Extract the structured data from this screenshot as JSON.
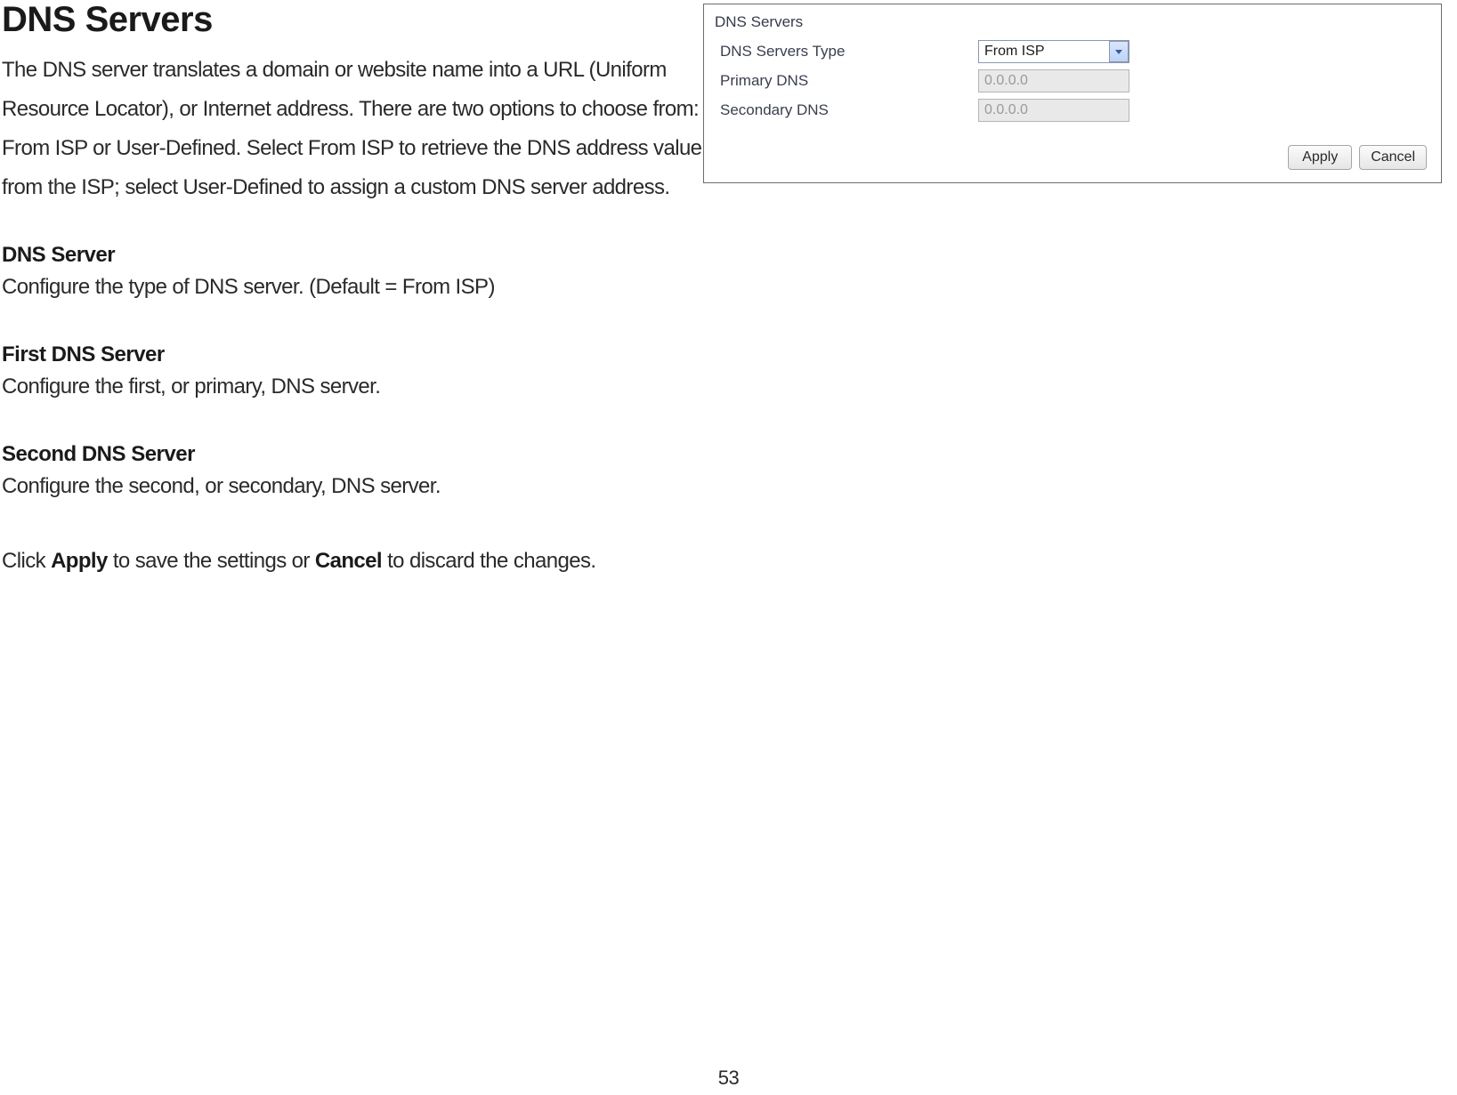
{
  "doc": {
    "heading": "DNS Servers",
    "intro": "The DNS server translates a domain or website name into a URL (Uniform Resource Locator), or Internet address. There are two options to choose from: From ISP or User-Defined. Select From ISP to retrieve the DNS address value from the ISP; select User-Defined to assign a custom DNS server address.",
    "sections": [
      {
        "title": "DNS Server",
        "body": "Configure the type of DNS server. (Default = From ISP)"
      },
      {
        "title": "First DNS Server",
        "body": "Configure the first, or primary, DNS server."
      },
      {
        "title": "Second DNS Server",
        "body": "Configure the second, or secondary, DNS server."
      }
    ],
    "final_pre": "Click ",
    "final_bold1": "Apply",
    "final_mid": " to save the settings or ",
    "final_bold2": "Cancel",
    "final_post": " to discard the changes.",
    "page_number": "53"
  },
  "panel": {
    "title": "DNS Servers",
    "rows": {
      "type_label": "DNS Servers Type",
      "type_value": "From ISP",
      "primary_label": "Primary DNS",
      "primary_placeholder": "0.0.0.0",
      "secondary_label": "Secondary DNS",
      "secondary_placeholder": "0.0.0.0"
    },
    "buttons": {
      "apply": "Apply",
      "cancel": "Cancel"
    }
  }
}
